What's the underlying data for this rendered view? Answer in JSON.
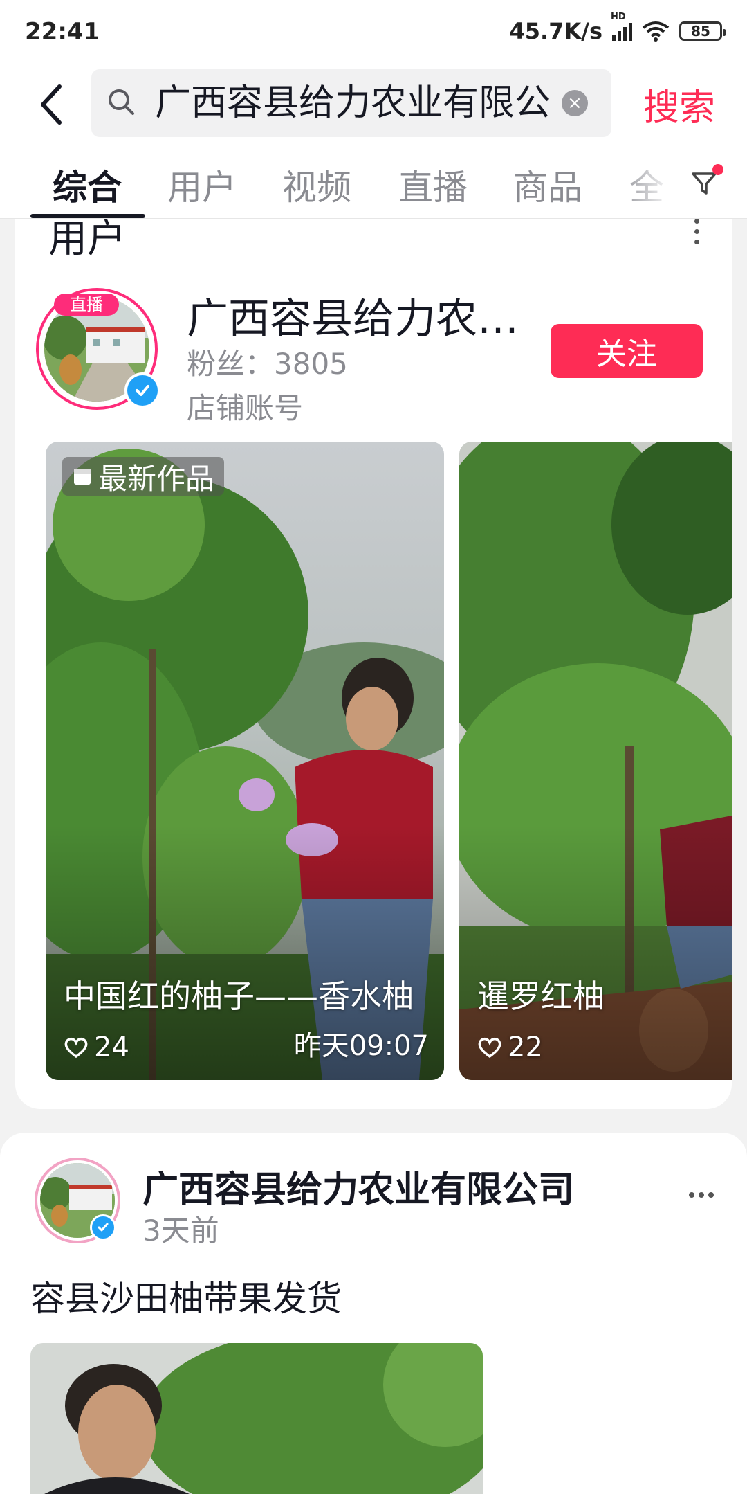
{
  "status_bar": {
    "time": "22:41",
    "net_speed": "45.7K/s",
    "signal_tag": "HD",
    "battery": "85"
  },
  "search": {
    "query": "广西容县给力农业有限公",
    "button": "搜索"
  },
  "tabs": [
    {
      "label": "综合",
      "active": true
    },
    {
      "label": "用户"
    },
    {
      "label": "视频"
    },
    {
      "label": "直播"
    },
    {
      "label": "商品"
    },
    {
      "label": "全"
    }
  ],
  "user_section": {
    "title": "用户",
    "user": {
      "name": "广西容县给力农…",
      "live_badge": "直播",
      "fans": "粉丝：3805",
      "account_type": "店铺账号",
      "follow_label": "关注"
    },
    "works": [
      {
        "tag": "最新作品",
        "title": "中国红的柚子——香水柚",
        "likes": "24",
        "time": "昨天09:07"
      },
      {
        "title": "暹罗红柚",
        "likes": "22"
      }
    ]
  },
  "post": {
    "author": "广西容县给力农业有限公司",
    "time": "3天前",
    "text": "容县沙田柚带果发货"
  },
  "colors": {
    "accent": "#fe2c55",
    "verified": "#1fa0f6",
    "live": "#fe2c7a"
  }
}
